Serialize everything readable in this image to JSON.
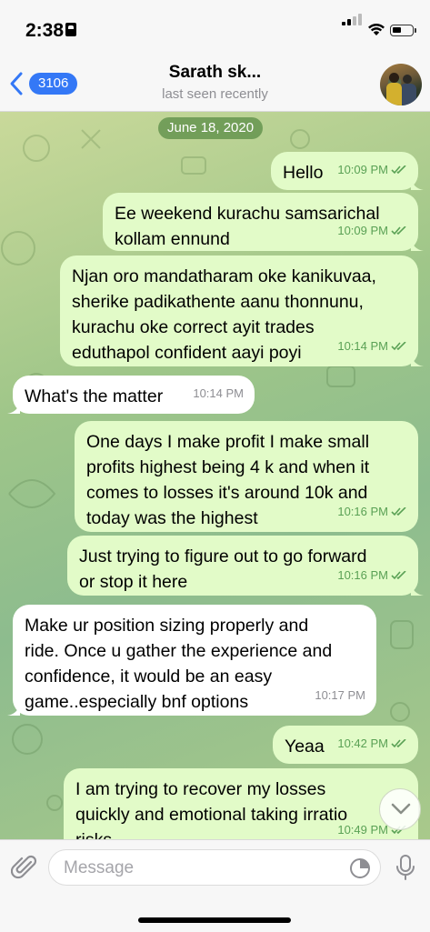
{
  "status_bar": {
    "time": "2:38"
  },
  "header": {
    "back_count": "3106",
    "title": "Sarath sk...",
    "status": "last seen recently"
  },
  "chat": {
    "date": "June 18, 2020",
    "messages": [
      {
        "dir": "out",
        "text": "Hello",
        "time": "10:09 PM"
      },
      {
        "dir": "out",
        "text": "Ee weekend kurachu samsarichal\nkollam ennund",
        "time": "10:09 PM"
      },
      {
        "dir": "out",
        "text": "Njan oro mandatharam oke kanikuvaa,\nsherike padikathente aanu thonnunu,\nkurachu oke correct ayit trades\neduthapol confident aayi poyi",
        "time": "10:14 PM"
      },
      {
        "dir": "in",
        "text": "What's the matter",
        "time": "10:14 PM"
      },
      {
        "dir": "out",
        "text": "One days I make profit I make small\nprofits highest being 4 k and when it\ncomes to losses it's around 10k and\ntoday was the highest",
        "time": "10:16 PM"
      },
      {
        "dir": "out",
        "text": "Just trying to figure out to go forward\nor stop it here",
        "time": "10:16 PM"
      },
      {
        "dir": "in",
        "text": "Make ur position sizing properly and\nride. Once u gather the experience and\nconfidence, it would be an easy\ngame..especially bnf options",
        "time": "10:17 PM"
      },
      {
        "dir": "out",
        "text": "Yeaa",
        "time": "10:42 PM"
      },
      {
        "dir": "out",
        "text": "I am trying to recover my losses\nquickly and emotional taking irratio\nrisks",
        "time": "10:49 PM"
      }
    ]
  },
  "input": {
    "placeholder": "Message"
  },
  "colors": {
    "accent": "#3478f6",
    "outgoing_bubble": "#e2fbc8",
    "incoming_bubble": "#ffffff",
    "check": "#5aa155"
  },
  "icons": [
    "signal-icon",
    "wifi-icon",
    "battery-icon",
    "back-chevron-icon",
    "attach-icon",
    "sticker-icon",
    "mic-icon",
    "chevron-down-icon",
    "double-check-icon"
  ]
}
